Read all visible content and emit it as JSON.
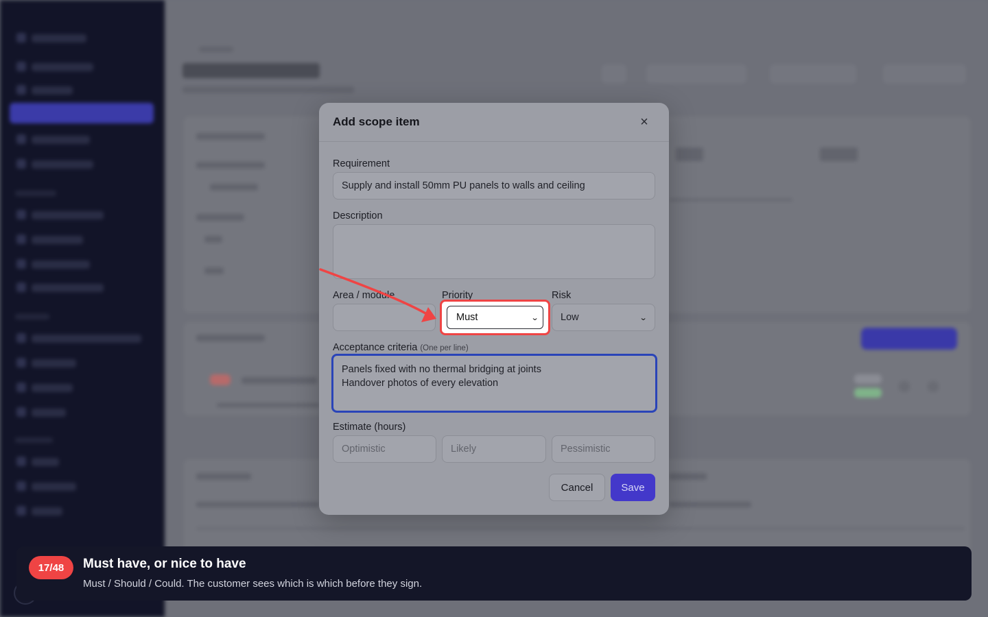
{
  "modal": {
    "title": "Add scope item",
    "requirement": {
      "label": "Requirement",
      "value": "Supply and install 50mm PU panels to walls and ceiling"
    },
    "description": {
      "label": "Description",
      "value": ""
    },
    "area": {
      "label": "Area / module",
      "value": ""
    },
    "priority": {
      "label": "Priority",
      "value": "Must",
      "options": [
        "Must"
      ]
    },
    "risk": {
      "label": "Risk",
      "value": "Low",
      "options": [
        "Low"
      ]
    },
    "acceptance": {
      "label": "Acceptance criteria",
      "hint": "(One per line)",
      "value": "Panels fixed with no thermal bridging at joints\nHandover photos of every elevation"
    },
    "estimate": {
      "label": "Estimate (hours)",
      "optimistic_placeholder": "Optimistic",
      "likely_placeholder": "Likely",
      "pessimistic_placeholder": "Pessimistic"
    },
    "cancel_label": "Cancel",
    "save_label": "Save"
  },
  "tour": {
    "step": "17/48",
    "title": "Must have, or nice to have",
    "body": "Must / Should / Could. The customer sees which is which before they sign."
  },
  "colors": {
    "accent": "#4338ca",
    "highlight": "#ef4444",
    "focus_ring": "#2a44b8",
    "toast_bg": "#141628"
  },
  "icons": {
    "close": "close-icon",
    "chevron": "chevron-down-icon"
  }
}
